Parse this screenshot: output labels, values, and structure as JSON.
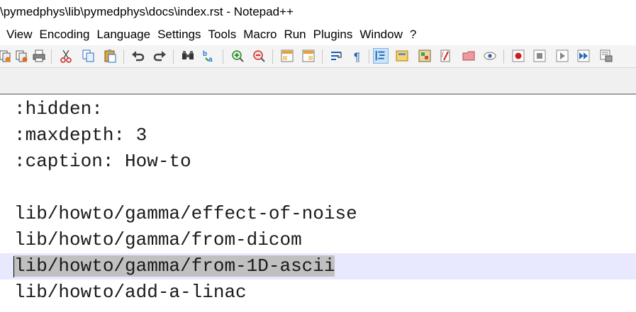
{
  "window": {
    "title": "\\pymedphys\\lib\\pymedphys\\docs\\index.rst - Notepad++"
  },
  "menu": [
    "View",
    "Encoding",
    "Language",
    "Settings",
    "Tools",
    "Macro",
    "Run",
    "Plugins",
    "Window",
    "?"
  ],
  "toolbar": {
    "icons": [
      "close-all-icon",
      "print-icon",
      "cut-icon",
      "copy-icon",
      "paste-icon",
      "undo-icon",
      "redo-icon",
      "find-icon",
      "replace-icon",
      "zoom-in-icon",
      "zoom-out-icon",
      "sync-vertical-icon",
      "sync-horizontal-icon",
      "word-wrap-icon",
      "show-all-chars-icon",
      "indent-guide-icon",
      "user-language-icon",
      "document-map-icon",
      "function-list-icon",
      "folder-workspace-icon",
      "monitoring-icon",
      "record-macro-icon",
      "stop-macro-icon",
      "play-macro-icon",
      "run-macro-multiple-icon",
      "save-macro-icon"
    ],
    "active_icon": "indent-guide-icon"
  },
  "editor": {
    "lines": [
      ":hidden:",
      ":maxdepth: 3",
      ":caption: How-to",
      "",
      "lib/howto/gamma/effect-of-noise",
      "lib/howto/gamma/from-dicom",
      "lib/howto/gamma/from-1D-ascii",
      "lib/howto/add-a-linac"
    ],
    "current_line_index": 6,
    "selected_text": "lib/howto/gamma/from-1D-ascii",
    "colors": {
      "current_line": "#e8e8ff",
      "selection": "#c0c0c0",
      "text": "#1a1a1a"
    }
  }
}
